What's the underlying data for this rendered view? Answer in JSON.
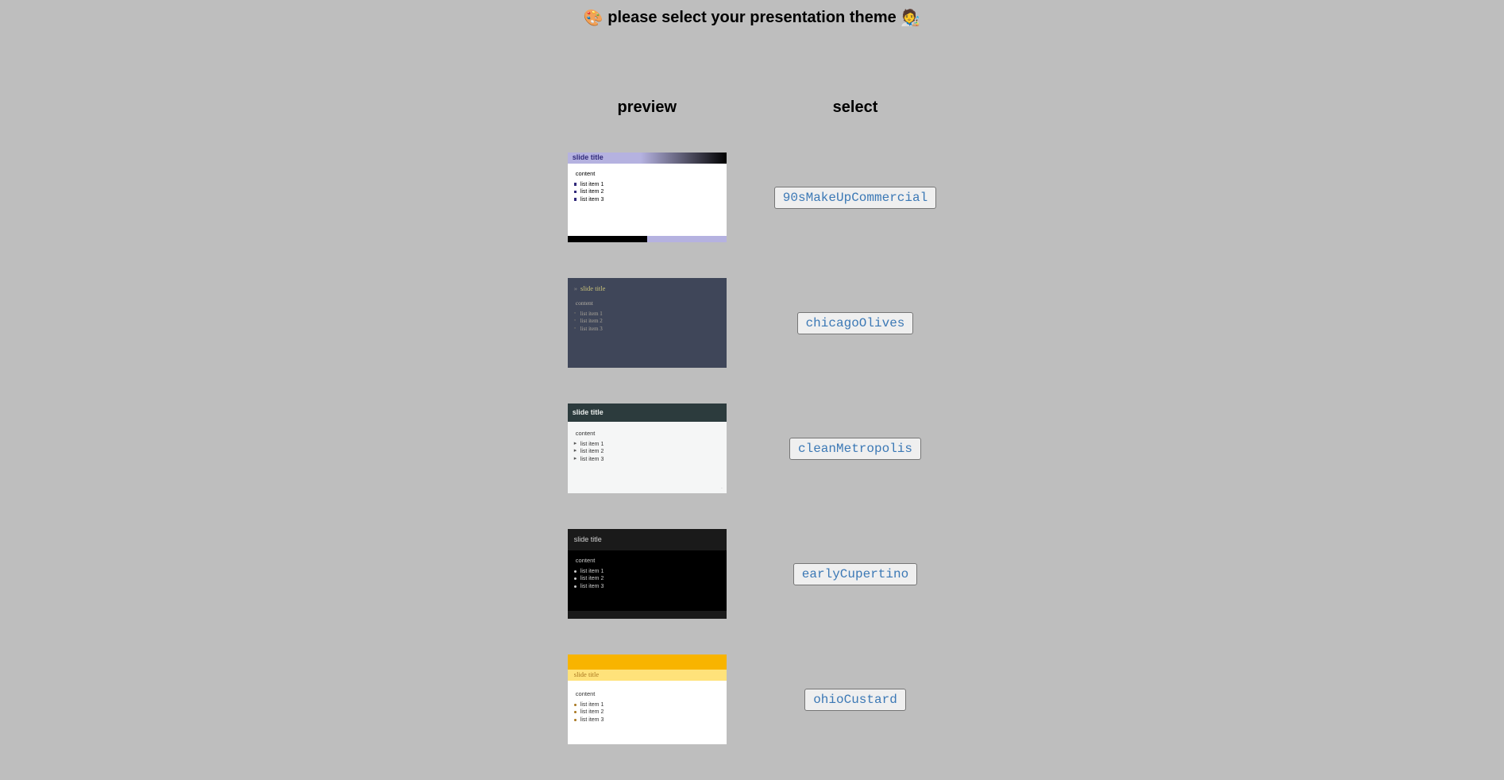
{
  "page": {
    "title_prefix_emoji": "🎨",
    "title_text": "please select your presentation theme",
    "title_suffix_emoji": "🧑‍🎨"
  },
  "headers": {
    "preview": "preview",
    "select": "select"
  },
  "slide_sample": {
    "title": "slide title",
    "content_label": "content",
    "items": [
      "list item 1",
      "list item 2",
      "list item 3"
    ]
  },
  "themes": [
    {
      "id": "90sMakeUpCommercial",
      "button_label": "90sMakeUpCommercial"
    },
    {
      "id": "chicagoOlives",
      "button_label": "chicagoOlives"
    },
    {
      "id": "cleanMetropolis",
      "button_label": "cleanMetropolis"
    },
    {
      "id": "earlyCupertino",
      "button_label": "earlyCupertino"
    },
    {
      "id": "ohioCustard",
      "button_label": "ohioCustard"
    }
  ]
}
